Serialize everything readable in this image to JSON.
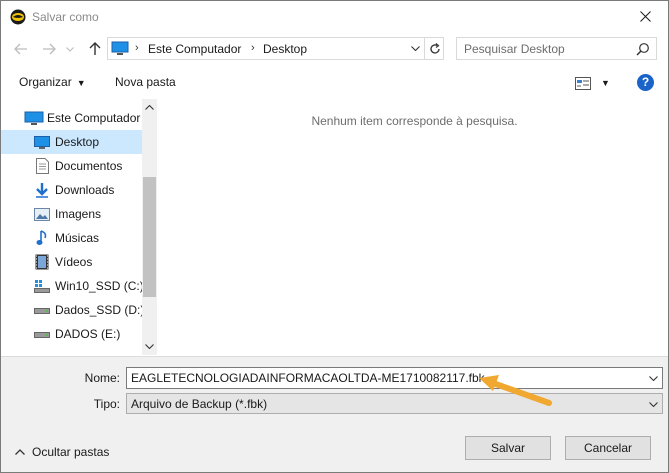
{
  "window": {
    "title": "Salvar como"
  },
  "address": {
    "crumbs": [
      "Este Computador",
      "Desktop"
    ]
  },
  "search": {
    "placeholder": "Pesquisar Desktop"
  },
  "toolbar": {
    "organize_label": "Organizar",
    "new_folder_label": "Nova pasta",
    "help_label": "?"
  },
  "sidebar": {
    "items": [
      {
        "label": "Este Computador",
        "icon": "computer-icon"
      },
      {
        "label": "Desktop",
        "icon": "desktop-icon",
        "selected": true
      },
      {
        "label": "Documentos",
        "icon": "documents-icon"
      },
      {
        "label": "Downloads",
        "icon": "downloads-icon"
      },
      {
        "label": "Imagens",
        "icon": "pictures-icon"
      },
      {
        "label": "Músicas",
        "icon": "music-icon"
      },
      {
        "label": "Vídeos",
        "icon": "videos-icon"
      },
      {
        "label": "Win10_SSD (C:)",
        "icon": "system-drive-icon"
      },
      {
        "label": "Dados_SSD (D:)",
        "icon": "drive-icon"
      },
      {
        "label": "DADOS (E:)",
        "icon": "drive-icon"
      }
    ]
  },
  "content": {
    "empty_message": "Nenhum item corresponde à pesquisa."
  },
  "form": {
    "name_label": "Nome:",
    "name_value": "EAGLETECNOLOGIADAINFORMACAOLTDA-ME1710082117.fbk",
    "type_label": "Tipo:",
    "type_value": "Arquivo de Backup (*.fbk)"
  },
  "footer": {
    "hide_folders_label": "Ocultar pastas",
    "save_label": "Salvar",
    "cancel_label": "Cancelar"
  },
  "colors": {
    "accent": "#1a64c9",
    "selection": "#cce8ff",
    "annotation_arrow": "#f0a830"
  }
}
